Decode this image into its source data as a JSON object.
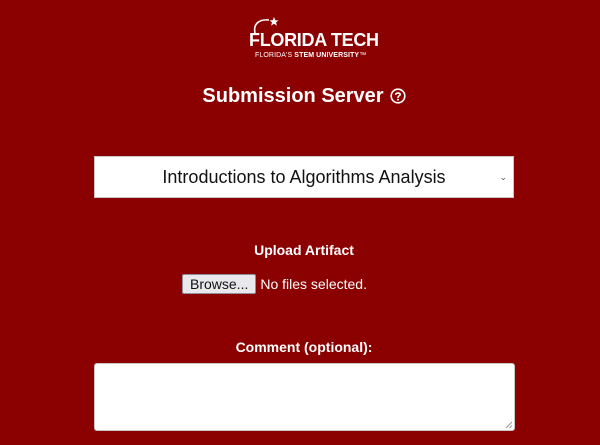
{
  "brand": {
    "wordmark": "FLORIDA TECH",
    "tagline_prefix": "FLORIDA'S ",
    "tagline_strong": "STEM UNIVERSITY",
    "tagline_mark": "™"
  },
  "header": {
    "title": "Submission Server",
    "help_icon": "question-circle-icon"
  },
  "course_select": {
    "selected": "Introductions to Algorithms Analysis",
    "icon": "chevron-down-icon"
  },
  "upload": {
    "label": "Upload Artifact",
    "browse_label": "Browse...",
    "status": "No files selected."
  },
  "comment": {
    "label": "Comment (optional):",
    "value": ""
  },
  "colors": {
    "background": "#8b0000",
    "text": "#ffffff"
  }
}
